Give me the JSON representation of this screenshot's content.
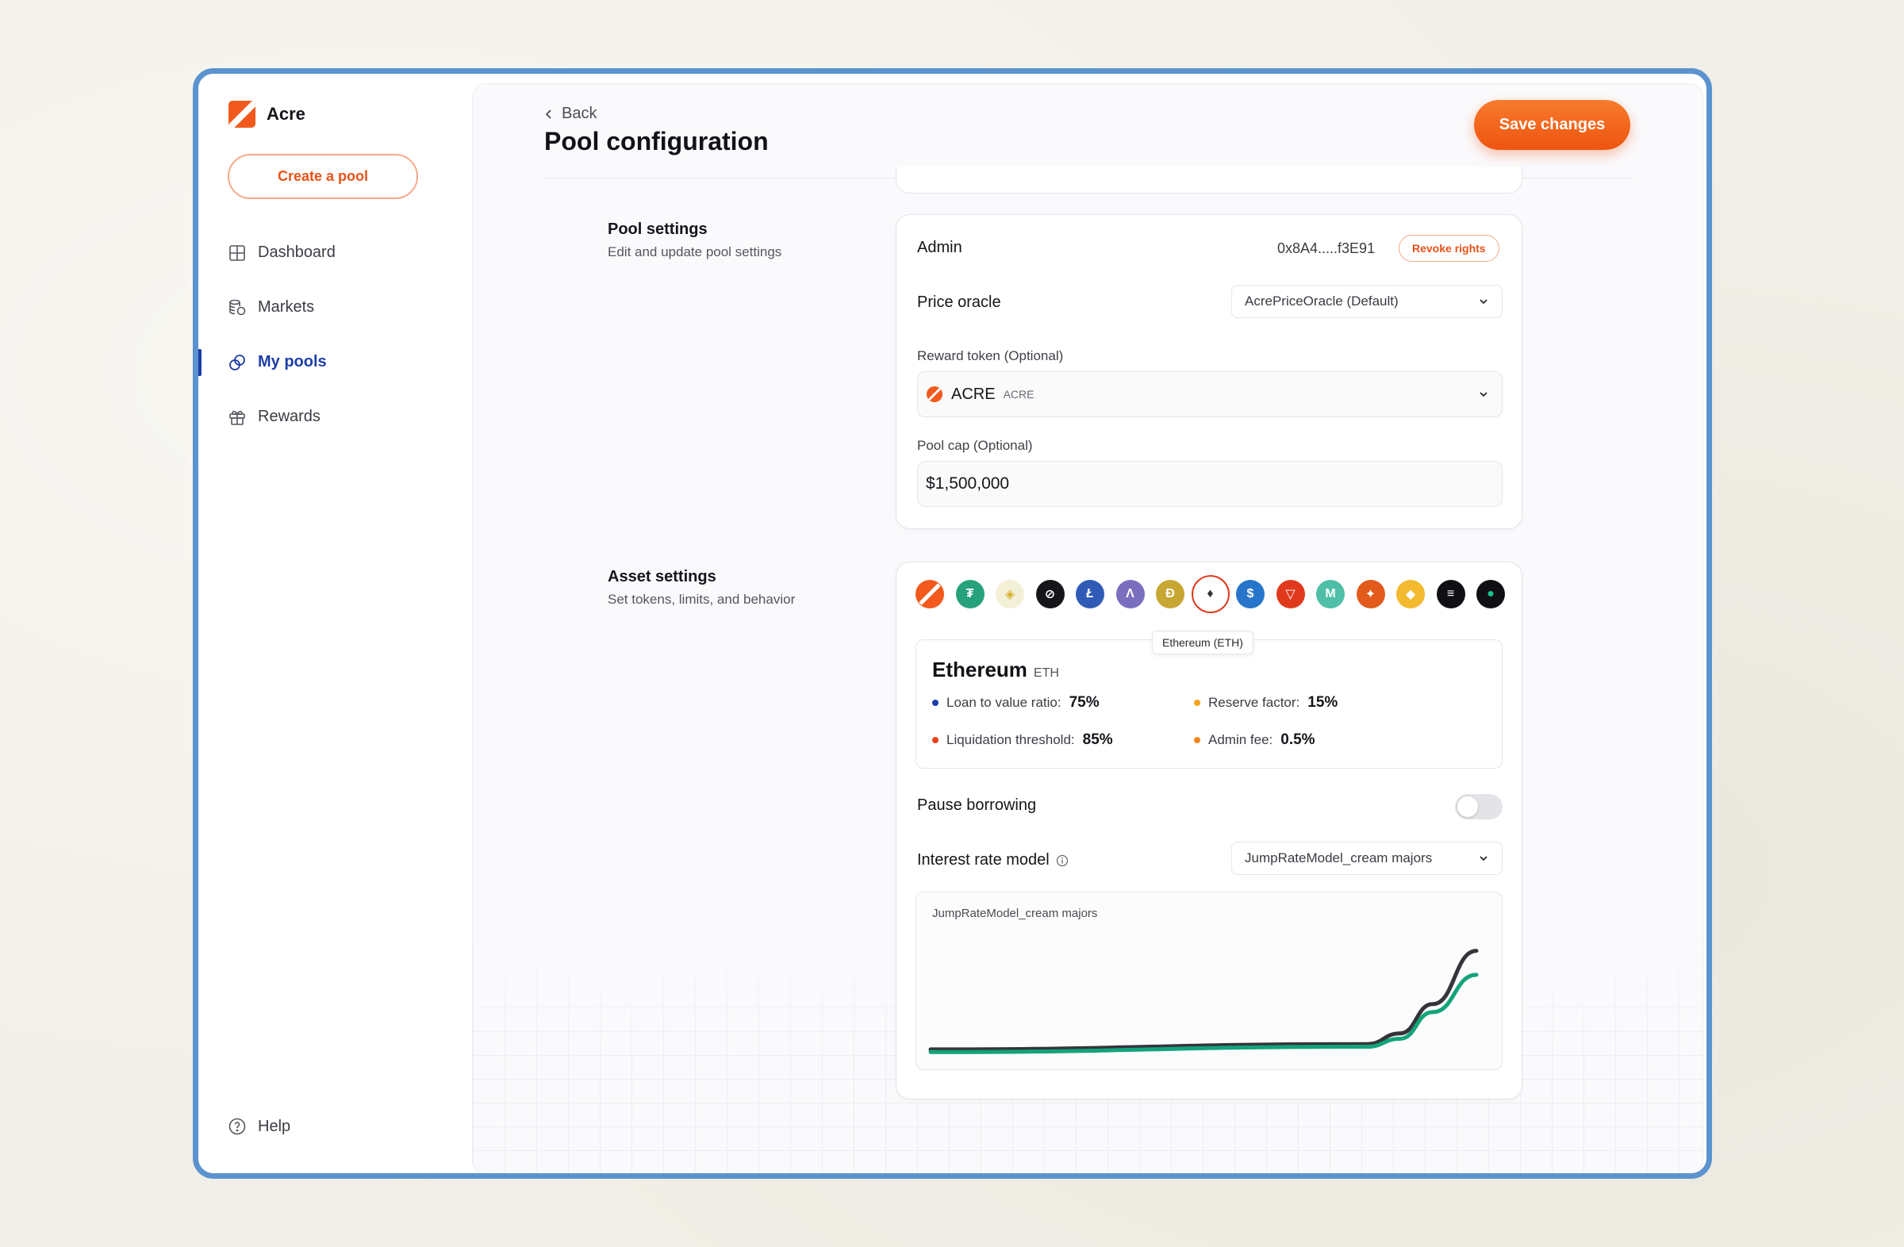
{
  "app": {
    "name": "Acre"
  },
  "sidebar": {
    "create_label": "Create a pool",
    "items": [
      {
        "label": "Dashboard",
        "icon": "grid-icon",
        "active": false
      },
      {
        "label": "Markets",
        "icon": "coins-icon",
        "active": false
      },
      {
        "label": "My pools",
        "icon": "pools-icon",
        "active": true
      },
      {
        "label": "Rewards",
        "icon": "gift-icon",
        "active": false
      }
    ],
    "help_label": "Help"
  },
  "header": {
    "back_label": "Back",
    "title": "Pool configuration",
    "save_label": "Save changes"
  },
  "pool_settings": {
    "title": "Pool settings",
    "subtitle": "Edit and update pool settings",
    "admin_label": "Admin",
    "admin_address": "0x8A4.....f3E91",
    "revoke_label": "Revoke rights",
    "price_oracle_label": "Price oracle",
    "price_oracle_value": "AcrePriceOracle (Default)",
    "reward_token_label": "Reward token (Optional)",
    "reward_token_name": "ACRE",
    "reward_token_symbol": "ACRE",
    "pool_cap_label": "Pool cap (Optional)",
    "pool_cap_value": "$1,500,000"
  },
  "asset_settings": {
    "title": "Asset settings",
    "subtitle": "Set tokens, limits, and behavior",
    "tokens": [
      {
        "icon": "acre-icon",
        "color": "#f25a1d"
      },
      {
        "icon": "tether-icon",
        "color": "#26a17b"
      },
      {
        "icon": "binance-usd-icon",
        "color": "#f3f0d8"
      },
      {
        "icon": "stellar-icon",
        "color": "#16161a"
      },
      {
        "icon": "litecoin-icon",
        "color": "#2f5bb7"
      },
      {
        "icon": "aave-icon",
        "color": "#7a6fbf"
      },
      {
        "icon": "dogecoin-icon",
        "color": "#c8a633"
      },
      {
        "icon": "ethereum-icon",
        "color": "#ffffff",
        "selected": true
      },
      {
        "icon": "usdc-icon",
        "color": "#2775ca"
      },
      {
        "icon": "tron-icon",
        "color": "#e0391c"
      },
      {
        "icon": "mstable-icon",
        "color": "#4fbfa8"
      },
      {
        "icon": "shiba-icon",
        "color": "#e25a1c"
      },
      {
        "icon": "bnb-icon",
        "color": "#f3ba2f"
      },
      {
        "icon": "solana-icon",
        "color": "#101014"
      },
      {
        "icon": "gt-icon",
        "color": "#101014"
      }
    ],
    "tooltip": "Ethereum (ETH)",
    "asset_name": "Ethereum",
    "asset_symbol": "ETH",
    "metrics": {
      "ltv_label": "Loan to value ratio:",
      "ltv_value": "75%",
      "ltv_color": "#1d3ea8",
      "reserve_label": "Reserve factor:",
      "reserve_value": "15%",
      "reserve_color": "#f3a51c",
      "liq_label": "Liquidation threshold:",
      "liq_value": "85%",
      "liq_color": "#e8421a",
      "admin_fee_label": "Admin fee:",
      "admin_fee_value": "0.5%",
      "admin_fee_color": "#f3861c"
    },
    "pause_label": "Pause borrowing",
    "pause_on": false,
    "irm_label": "Interest rate model",
    "irm_value": "JumpRateModel_cream majors"
  },
  "chart_data": {
    "type": "line",
    "title": "JumpRateModel_cream majors",
    "xlim": [
      0,
      100
    ],
    "ylim": [
      0,
      100
    ],
    "grid": false,
    "series": [
      {
        "color": "#34343a",
        "x": [
          0,
          80,
          86,
          92,
          100
        ],
        "y": [
          6,
          10,
          18,
          40,
          80
        ]
      },
      {
        "color": "#13a37a",
        "x": [
          0,
          80,
          86,
          92,
          100
        ],
        "y": [
          4,
          8,
          14,
          34,
          62
        ]
      }
    ]
  }
}
